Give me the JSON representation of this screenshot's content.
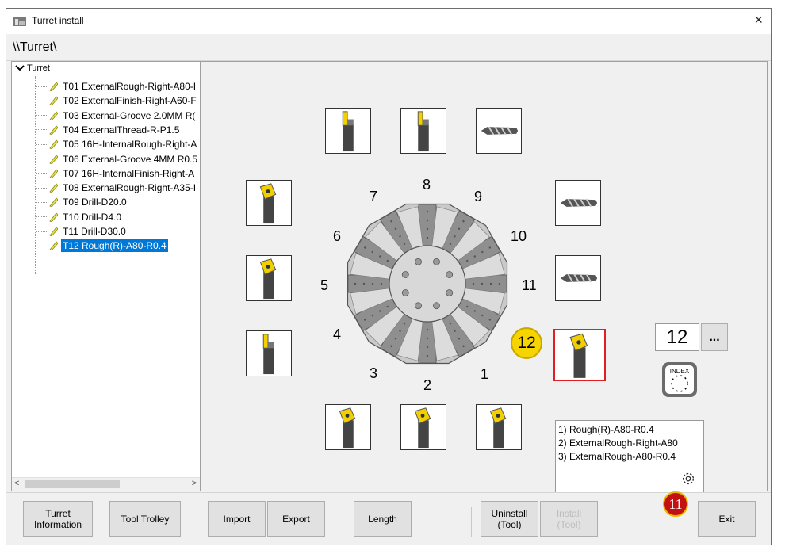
{
  "window": {
    "title": "Turret install",
    "close_glyph": "×"
  },
  "path": "\\\\Turret\\",
  "tree": {
    "root_label": "Turret",
    "items": [
      {
        "label": "T01 ExternalRough-Right-A80-I"
      },
      {
        "label": "T02 ExternalFinish-Right-A60-F"
      },
      {
        "label": "T03 External-Groove 2.0MM R("
      },
      {
        "label": "T04 ExternalThread-R-P1.5"
      },
      {
        "label": "T05 16H-InternalRough-Right-A"
      },
      {
        "label": "T06 External-Groove 4MM R0.5"
      },
      {
        "label": "T07 16H-InternalFinish-Right-A"
      },
      {
        "label": "T08 ExternalRough-Right-A35-I"
      },
      {
        "label": "T09 Drill-D20.0"
      },
      {
        "label": "T10 Drill-D4.0"
      },
      {
        "label": "T11 Drill-D30.0"
      },
      {
        "label": "T12 Rough(R)-A80-R0.4",
        "selected": true
      }
    ]
  },
  "turret": {
    "station_numbers": [
      "1",
      "2",
      "3",
      "4",
      "5",
      "6",
      "7",
      "8",
      "9",
      "10",
      "11",
      "12"
    ],
    "selected_station_badge": "12",
    "index_value": "12",
    "more_label": "...",
    "index_icon_label": "INDEX",
    "tool_types": [
      "turning",
      "turning",
      "turning",
      "groove",
      "turning",
      "turning",
      "groove",
      "groove",
      "drill",
      "drill",
      "drill",
      "turning"
    ]
  },
  "info_lines": [
    "1) Rough(R)-A80-R0.4",
    "2) ExternalRough-Right-A80",
    "3) ExternalRough-A80-R0.4"
  ],
  "bottom": {
    "turret_info": "Turret\nInformation",
    "tool_trolley": "Tool Trolley",
    "import": "Import",
    "export": "Export",
    "length": "Length",
    "uninstall": "Uninstall\n(Tool)",
    "install": "Install\n(Tool)",
    "exit": "Exit",
    "badge": "11"
  },
  "colors": {
    "accent": "#0078d7",
    "selected_border": "#e02020",
    "badge_yellow": "#f5d400",
    "badge_red": "#c41010"
  }
}
